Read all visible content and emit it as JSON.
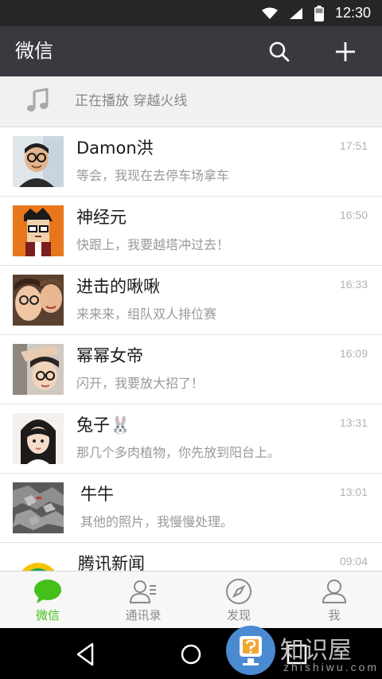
{
  "status_bar": {
    "time": "12:30"
  },
  "header": {
    "title": "微信"
  },
  "now_playing": {
    "text": "正在播放  穿越火线"
  },
  "chats": [
    {
      "name": "Damon洪",
      "time": "17:51",
      "message": "等会，我现在去停车场拿车"
    },
    {
      "name": "神经元",
      "time": "16:50",
      "message": "快跟上，我要越塔冲过去！"
    },
    {
      "name": "进击的啾啾",
      "time": "16:33",
      "message": "来来来，组队双人排位赛"
    },
    {
      "name": "幂幂女帝",
      "time": "16:09",
      "message": "闪开，我要放大招了！"
    },
    {
      "name": "兔子🐰",
      "time": "13:31",
      "message": "那几个多肉植物，你先放到阳台上。"
    },
    {
      "name": "牛牛",
      "time": "13:01",
      "message": "其他的照片，我慢慢处理。"
    },
    {
      "name": "腾讯新闻",
      "time": "09:04",
      "message": ""
    }
  ],
  "tabs": [
    {
      "label": "微信",
      "icon": "chat-bubble-icon",
      "active": true
    },
    {
      "label": "通讯录",
      "icon": "contacts-icon",
      "active": false
    },
    {
      "label": "发现",
      "icon": "compass-icon",
      "active": false
    },
    {
      "label": "我",
      "icon": "person-icon",
      "active": false
    }
  ],
  "watermark": {
    "text": "知识屋",
    "sub": "zhishiwu.com"
  },
  "colors": {
    "accent_green": "#45c01a",
    "app_bar": "#393a3f",
    "status_bar": "#262626"
  }
}
